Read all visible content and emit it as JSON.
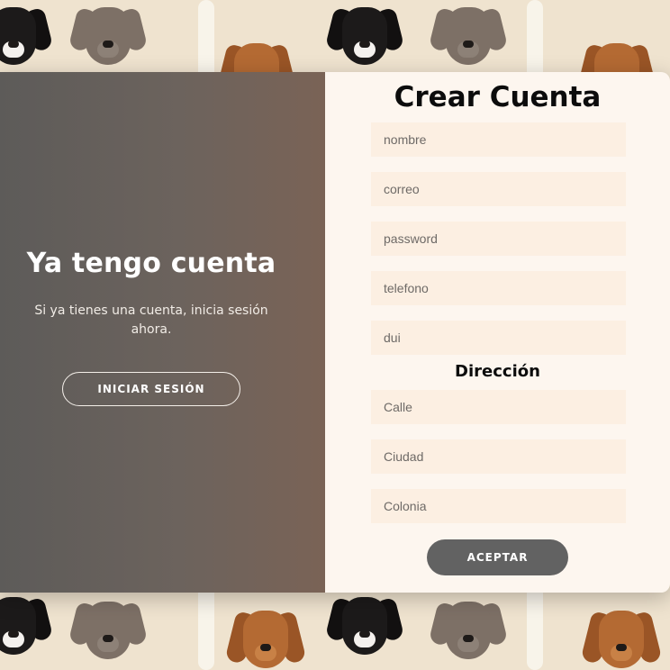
{
  "left_panel": {
    "title": "Ya tengo cuenta",
    "text": "Si ya tienes una cuenta, inicia sesión ahora.",
    "login_button": "INICIAR SESIÓN"
  },
  "form": {
    "title": "Crear Cuenta",
    "fields": {
      "nombre": "nombre",
      "correo": "correo",
      "password": "password",
      "telefono": "telefono",
      "dui": "dui"
    },
    "address_title": "Dirección",
    "address_fields": {
      "calle": "Calle",
      "ciudad": "Ciudad",
      "colonia": "Colonia"
    },
    "submit_button": "ACEPTAR"
  },
  "colors": {
    "left_gradient_start": "#5d5b59",
    "left_gradient_end": "#7a6356",
    "form_background": "#fdf6ef",
    "field_background": "#fcefe2",
    "accept_button": "#626262"
  }
}
